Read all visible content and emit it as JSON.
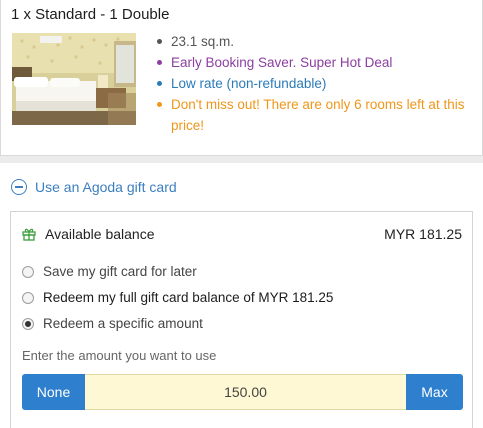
{
  "room": {
    "title": "1 x Standard - 1 Double",
    "photo": "hotel-room-photo",
    "features": {
      "size": "23.1 sq.m.",
      "deal": "Early Booking Saver. Super Hot Deal",
      "rate": "Low rate (non-refundable)",
      "warning": "Don't miss out! There are only 6 rooms left at this price!"
    }
  },
  "gift_card": {
    "toggle_label": "Use an Agoda gift card",
    "toggle_icon": "minus-circle-icon",
    "balance_icon": "gift-icon",
    "balance_label": "Available balance",
    "balance_amount": "MYR 181.25",
    "options": {
      "save": "Save my gift card for later",
      "full": "Redeem my full gift card balance of MYR 181.25",
      "specific": "Redeem a specific amount"
    },
    "selected_option": "specific",
    "amount_hint": "Enter the amount you want to use",
    "amount_value": "150.00",
    "none_label": "None",
    "max_label": "Max"
  },
  "colors": {
    "link_blue": "#3b7fc0",
    "button_blue": "#2f7fcf",
    "deal_purple": "#8c3fa0",
    "rate_blue": "#2b7bb9",
    "warning_orange": "#f0961a",
    "gift_green": "#3e9f3e",
    "input_yellow": "#fff8d4"
  }
}
